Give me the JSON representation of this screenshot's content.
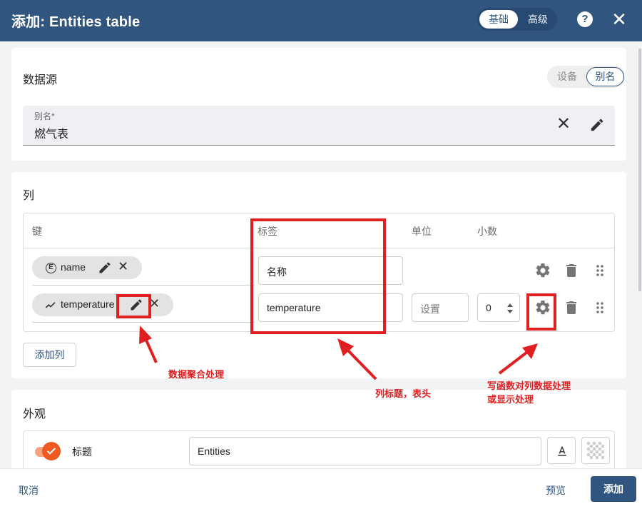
{
  "header": {
    "title": "添加: Entities table",
    "mode_basic": "基础",
    "mode_advanced": "高级",
    "help_icon": "help-icon",
    "close_icon": "close-icon"
  },
  "datasource": {
    "title": "数据源",
    "toggle_device": "设备",
    "toggle_alias": "别名",
    "alias_label": "别名*",
    "alias_value": "燃气表"
  },
  "columns": {
    "title": "列",
    "headers": {
      "key": "键",
      "label": "标签",
      "unit": "单位",
      "decimals": "小数"
    },
    "rows": [
      {
        "key": "name",
        "key_icon": "entity-icon",
        "label": "名称",
        "unit": "",
        "decimals": ""
      },
      {
        "key": "temperature",
        "key_icon": "timeseries-icon",
        "label": "temperature",
        "unit_placeholder": "设置",
        "decimals": "0"
      }
    ],
    "add_button": "添加列"
  },
  "annotations": {
    "aggregation": "数据聚合处理",
    "header_note": "列标题，表头",
    "function_line1": "写函数对列数据处理",
    "function_line2": "或显示处理",
    "color": "#e02020"
  },
  "appearance": {
    "title": "外观",
    "title_toggle_label": "标题",
    "title_value": "Entities",
    "toggle_on": true
  },
  "footer": {
    "cancel": "取消",
    "preview": "预览",
    "add": "添加"
  },
  "colors": {
    "primary": "#305680",
    "accent": "#f05a22"
  }
}
